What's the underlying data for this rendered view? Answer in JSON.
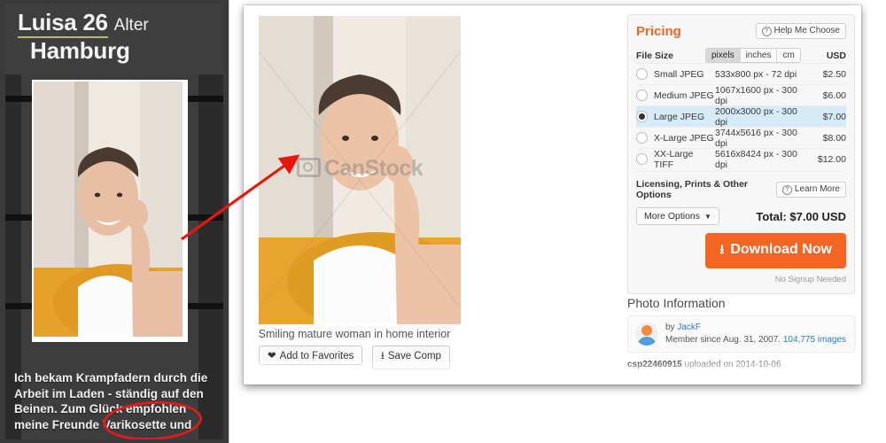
{
  "ad": {
    "name": "Luisa 26",
    "age_label": "Alter",
    "city": "Hamburg",
    "testimonial": "Ich bekam Krampfadern durch die Arbeit im Laden - ständig auf den Beinen. Zum Glück empfohlen meine Freunde Varikosette und",
    "highlight_color": "#e01b1b",
    "underline_color": "#b9bd6a"
  },
  "annotation": {
    "arrow_color": "#e8170e"
  },
  "preview": {
    "watermark": "CanStock",
    "caption": "Smiling mature woman in home interior",
    "favorites_button": "Add to Favorites",
    "favorites_icon": "heart-icon",
    "savecomp_button": "Save Comp",
    "savecomp_icon": "download-icon"
  },
  "pricing": {
    "title": "Pricing",
    "accent_color": "#f26522",
    "help_button": "Help Me Choose",
    "file_size_label": "File Size",
    "units": [
      {
        "label": "pixels",
        "selected": true
      },
      {
        "label": "inches",
        "selected": false
      },
      {
        "label": "cm",
        "selected": false
      }
    ],
    "currency_label": "USD",
    "rows": [
      {
        "name": "Small JPEG",
        "dimensions": "533x800 px - 72 dpi",
        "price": "$2.50",
        "selected": false
      },
      {
        "name": "Medium JPEG",
        "dimensions": "1067x1600 px - 300 dpi",
        "price": "$6.00",
        "selected": false
      },
      {
        "name": "Large JPEG",
        "dimensions": "2000x3000 px - 300 dpi",
        "price": "$7.00",
        "selected": true
      },
      {
        "name": "X-Large JPEG",
        "dimensions": "3744x5616 px - 300 dpi",
        "price": "$8.00",
        "selected": false
      },
      {
        "name": "XX-Large TIFF",
        "dimensions": "5616x8424 px - 300 dpi",
        "price": "$12.00",
        "selected": false
      }
    ],
    "licensing_label": "Licensing, Prints & Other Options",
    "learn_more_button": "Learn More",
    "more_options_button": "More Options",
    "total": "Total: $7.00 USD",
    "download_button": "Download Now",
    "no_signup": "No Signup Needed"
  },
  "photo_info": {
    "title": "Photo Information",
    "by_label": "by",
    "author": "JackF",
    "member_since": "Member since Aug. 31, 2007.",
    "image_count": "104,775 images",
    "csp_id": "csp22460915",
    "upload_text": "uploaded on 2014-10-06"
  }
}
